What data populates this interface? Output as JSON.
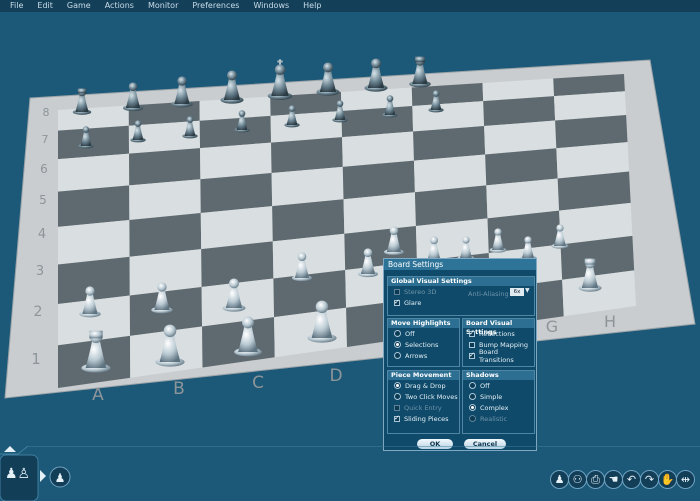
{
  "menu": [
    "File",
    "Edit",
    "Game",
    "Actions",
    "Monitor",
    "Preferences",
    "Windows",
    "Help"
  ],
  "board": {
    "ranks": [
      "8",
      "7",
      "6",
      "5",
      "4",
      "3",
      "2",
      "1"
    ],
    "files": [
      "A",
      "B",
      "C",
      "D",
      "E",
      "F",
      "G",
      "H"
    ]
  },
  "dialog": {
    "title": "Board Settings",
    "global": {
      "header": "Global Visual Settings",
      "stereo_label": "Stereo 3D",
      "glare_label": "Glare",
      "antialias_label": "Anti-Aliasing",
      "antialias_value": "6x"
    },
    "move_highlights": {
      "header": "Move Highlights",
      "options": [
        "Off",
        "Selections",
        "Arrows"
      ],
      "selected": "Selections"
    },
    "board_visual": {
      "header": "Board Visual Settings",
      "options": [
        "Reflections",
        "Bump Mapping",
        "Board Transitions"
      ],
      "checked": [
        "Reflections",
        "Board Transitions"
      ]
    },
    "piece_movement": {
      "header": "Piece Movement",
      "options": [
        "Drag & Drop",
        "Two Click Moves",
        "Quick Entry",
        "Sliding Pieces"
      ]
    },
    "shadows": {
      "header": "Shadows",
      "options": [
        "Off",
        "Simple",
        "Complex",
        "Realistic"
      ],
      "selected": "Complex"
    },
    "ok": "OK",
    "cancel": "Cancel"
  },
  "colors": {
    "background": "#1c5878",
    "light_square": "#d9dee0",
    "dark_square": "#5f6a70",
    "frame": "#c9cdcf",
    "accent": "#2e7498"
  },
  "icons": [
    "pawn-icon",
    "players-icon",
    "printer-icon",
    "hand-icon",
    "undo-icon",
    "redo-icon",
    "stop-hand-icon",
    "split-icon"
  ]
}
